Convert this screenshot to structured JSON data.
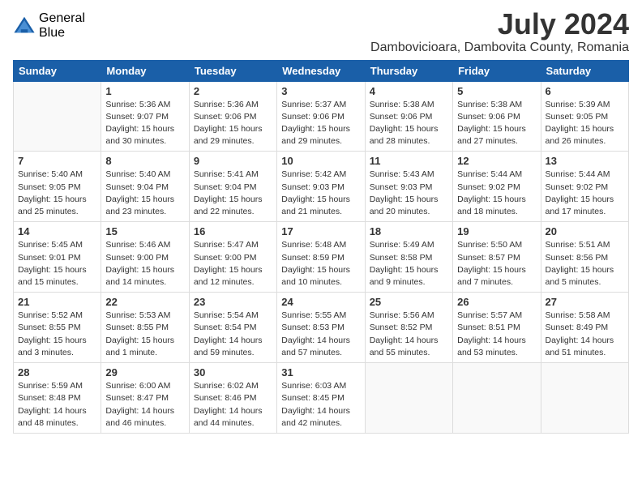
{
  "logo": {
    "general": "General",
    "blue": "Blue"
  },
  "title": {
    "month_year": "July 2024",
    "location": "Dambovicioara, Dambovita County, Romania"
  },
  "days_of_week": [
    "Sunday",
    "Monday",
    "Tuesday",
    "Wednesday",
    "Thursday",
    "Friday",
    "Saturday"
  ],
  "weeks": [
    [
      {
        "day": "",
        "info": ""
      },
      {
        "day": "1",
        "info": "Sunrise: 5:36 AM\nSunset: 9:07 PM\nDaylight: 15 hours\nand 30 minutes."
      },
      {
        "day": "2",
        "info": "Sunrise: 5:36 AM\nSunset: 9:06 PM\nDaylight: 15 hours\nand 29 minutes."
      },
      {
        "day": "3",
        "info": "Sunrise: 5:37 AM\nSunset: 9:06 PM\nDaylight: 15 hours\nand 29 minutes."
      },
      {
        "day": "4",
        "info": "Sunrise: 5:38 AM\nSunset: 9:06 PM\nDaylight: 15 hours\nand 28 minutes."
      },
      {
        "day": "5",
        "info": "Sunrise: 5:38 AM\nSunset: 9:06 PM\nDaylight: 15 hours\nand 27 minutes."
      },
      {
        "day": "6",
        "info": "Sunrise: 5:39 AM\nSunset: 9:05 PM\nDaylight: 15 hours\nand 26 minutes."
      }
    ],
    [
      {
        "day": "7",
        "info": "Sunrise: 5:40 AM\nSunset: 9:05 PM\nDaylight: 15 hours\nand 25 minutes."
      },
      {
        "day": "8",
        "info": "Sunrise: 5:40 AM\nSunset: 9:04 PM\nDaylight: 15 hours\nand 23 minutes."
      },
      {
        "day": "9",
        "info": "Sunrise: 5:41 AM\nSunset: 9:04 PM\nDaylight: 15 hours\nand 22 minutes."
      },
      {
        "day": "10",
        "info": "Sunrise: 5:42 AM\nSunset: 9:03 PM\nDaylight: 15 hours\nand 21 minutes."
      },
      {
        "day": "11",
        "info": "Sunrise: 5:43 AM\nSunset: 9:03 PM\nDaylight: 15 hours\nand 20 minutes."
      },
      {
        "day": "12",
        "info": "Sunrise: 5:44 AM\nSunset: 9:02 PM\nDaylight: 15 hours\nand 18 minutes."
      },
      {
        "day": "13",
        "info": "Sunrise: 5:44 AM\nSunset: 9:02 PM\nDaylight: 15 hours\nand 17 minutes."
      }
    ],
    [
      {
        "day": "14",
        "info": "Sunrise: 5:45 AM\nSunset: 9:01 PM\nDaylight: 15 hours\nand 15 minutes."
      },
      {
        "day": "15",
        "info": "Sunrise: 5:46 AM\nSunset: 9:00 PM\nDaylight: 15 hours\nand 14 minutes."
      },
      {
        "day": "16",
        "info": "Sunrise: 5:47 AM\nSunset: 9:00 PM\nDaylight: 15 hours\nand 12 minutes."
      },
      {
        "day": "17",
        "info": "Sunrise: 5:48 AM\nSunset: 8:59 PM\nDaylight: 15 hours\nand 10 minutes."
      },
      {
        "day": "18",
        "info": "Sunrise: 5:49 AM\nSunset: 8:58 PM\nDaylight: 15 hours\nand 9 minutes."
      },
      {
        "day": "19",
        "info": "Sunrise: 5:50 AM\nSunset: 8:57 PM\nDaylight: 15 hours\nand 7 minutes."
      },
      {
        "day": "20",
        "info": "Sunrise: 5:51 AM\nSunset: 8:56 PM\nDaylight: 15 hours\nand 5 minutes."
      }
    ],
    [
      {
        "day": "21",
        "info": "Sunrise: 5:52 AM\nSunset: 8:55 PM\nDaylight: 15 hours\nand 3 minutes."
      },
      {
        "day": "22",
        "info": "Sunrise: 5:53 AM\nSunset: 8:55 PM\nDaylight: 15 hours\nand 1 minute."
      },
      {
        "day": "23",
        "info": "Sunrise: 5:54 AM\nSunset: 8:54 PM\nDaylight: 14 hours\nand 59 minutes."
      },
      {
        "day": "24",
        "info": "Sunrise: 5:55 AM\nSunset: 8:53 PM\nDaylight: 14 hours\nand 57 minutes."
      },
      {
        "day": "25",
        "info": "Sunrise: 5:56 AM\nSunset: 8:52 PM\nDaylight: 14 hours\nand 55 minutes."
      },
      {
        "day": "26",
        "info": "Sunrise: 5:57 AM\nSunset: 8:51 PM\nDaylight: 14 hours\nand 53 minutes."
      },
      {
        "day": "27",
        "info": "Sunrise: 5:58 AM\nSunset: 8:49 PM\nDaylight: 14 hours\nand 51 minutes."
      }
    ],
    [
      {
        "day": "28",
        "info": "Sunrise: 5:59 AM\nSunset: 8:48 PM\nDaylight: 14 hours\nand 48 minutes."
      },
      {
        "day": "29",
        "info": "Sunrise: 6:00 AM\nSunset: 8:47 PM\nDaylight: 14 hours\nand 46 minutes."
      },
      {
        "day": "30",
        "info": "Sunrise: 6:02 AM\nSunset: 8:46 PM\nDaylight: 14 hours\nand 44 minutes."
      },
      {
        "day": "31",
        "info": "Sunrise: 6:03 AM\nSunset: 8:45 PM\nDaylight: 14 hours\nand 42 minutes."
      },
      {
        "day": "",
        "info": ""
      },
      {
        "day": "",
        "info": ""
      },
      {
        "day": "",
        "info": ""
      }
    ]
  ]
}
